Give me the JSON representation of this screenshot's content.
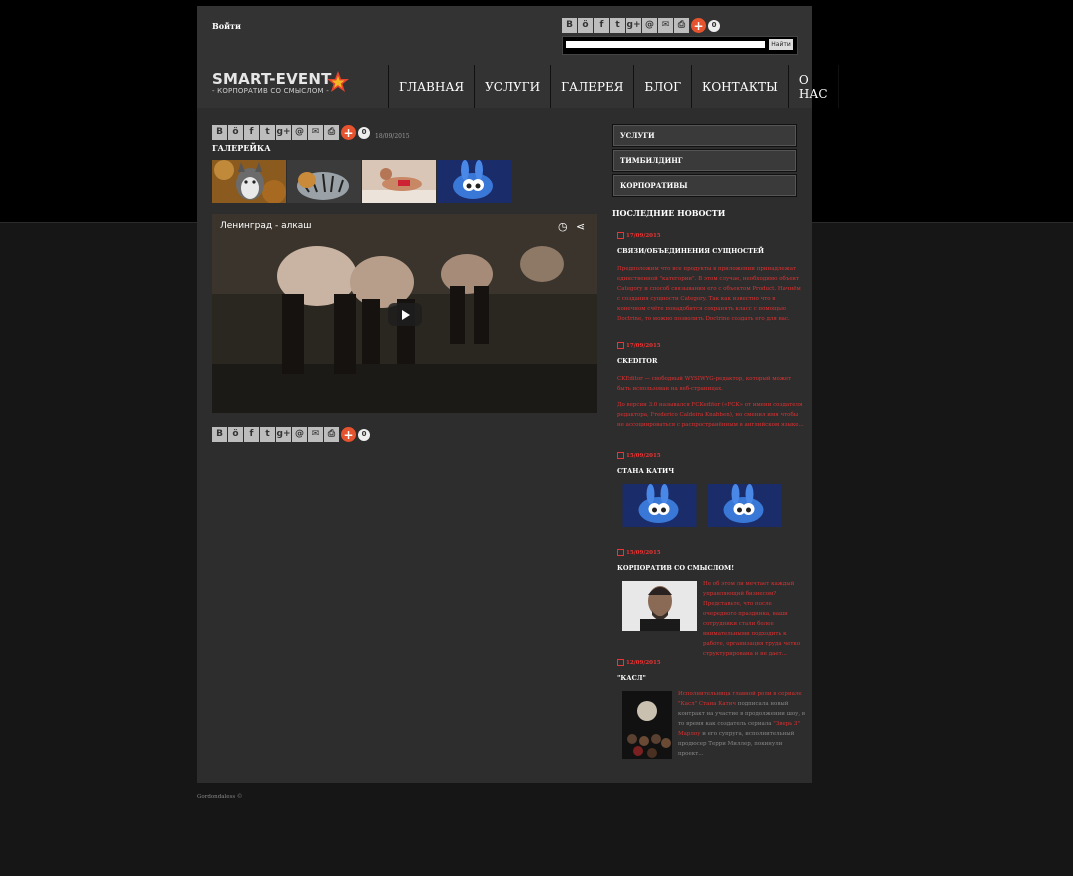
{
  "header": {
    "login_label": "Войти",
    "search": {
      "placeholder": "",
      "button_label": "Найти"
    },
    "share": {
      "labels": [
        "В",
        "ö",
        "f",
        "t",
        "g+",
        "@",
        "✉",
        "⎙"
      ],
      "count": "0"
    }
  },
  "logo": {
    "main": "SMART-EVENT",
    "sub": "- КОРПОРАТИВ СО СМЫСЛОМ -"
  },
  "nav": {
    "items": [
      "ГЛАВНАЯ",
      "УСЛУГИ",
      "ГАЛЕРЕЯ",
      "БЛОГ",
      "КОНТАКТЫ",
      "О НАС"
    ]
  },
  "content": {
    "date": "18/09/2015",
    "title": "ГАЛЕРЕЙКА",
    "video_title": "Ленинград - алкаш",
    "share_count": "0"
  },
  "sidebar": {
    "menu": [
      "УСЛУГИ",
      "ТИМБИЛДИНГ",
      "КОРПОРАТИВЫ"
    ],
    "news_heading": "ПОСЛЕДНИЕ НОВОСТИ",
    "news": [
      {
        "date": "17/09/2015",
        "title": "СВЯЗИ/ОБЪЕДИНЕНИЯ СУЩНОСТЕЙ",
        "text": "Предположим что все продукты в приложении принадлежат единственной \"категории\". В этом случае, необходимо объект Category и способ связывания его с объектом Product. Начнём с создания сущности Category. Так как известно что в конечном счёте понадобится сохранять класс с помощью Doctrine, то можно позволить Doctrine создать его для вас."
      },
      {
        "date": "17/09/2015",
        "title": "CKEDITOR",
        "text": "CKEditor — свободный WYSIWYG-редактор, который может быть использован на веб-страницах.",
        "text2": "До версии 3.0 назывался FCKeditor («FCK» от имени создателя редактора, Frederico Caldeira Knabben), но сменил имя чтобы не ассоциироваться с распространённым в английском языке..."
      },
      {
        "date": "15/09/2015",
        "title": "СТАНА КАТИЧ"
      },
      {
        "date": "15/09/2015",
        "title": "КОРПОРАТИВ СО СМЫСЛОМ!",
        "text": "Не об этом ли мечтает каждый управляющий бизнесом? Представьте, что после очередного праздника, ваши сотрудники стали более внимательными подходить к работе, организация труда четко структурирована и не дает..."
      },
      {
        "date": "12/09/2015",
        "title": "\"КАСЛ\"",
        "text_a": "Исполнительница главной роли в сериале \"Касл\" Стана Катич",
        "text_b": " подписала новый контракт на участие в продолжении шоу, в то время как создатель сериала ",
        "text_c": "\"Зверь 3\" Марлоу",
        "text_d": " и его супруга, исполнительный продюсер Терри Миллер, покинули проект..."
      }
    ]
  },
  "footer": {
    "text": "Gordondaless ©"
  },
  "colors": {
    "accent_red": "#e03030",
    "plus_orange": "#e6532f",
    "page_bg": "#2d2d2d"
  }
}
